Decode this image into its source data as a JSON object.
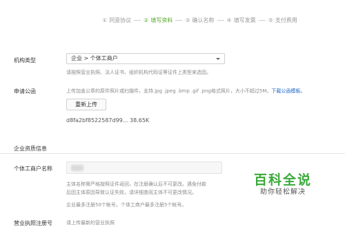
{
  "steps": [
    {
      "num": "①",
      "label": "同意协议"
    },
    {
      "num": "②",
      "label": "填写资料"
    },
    {
      "num": "③",
      "label": "确认名称"
    },
    {
      "num": "④",
      "label": "填写发票"
    },
    {
      "num": "⑤",
      "label": "支付费用"
    }
  ],
  "org_type": {
    "label": "机构类型",
    "selected": "企业 > 个体工商户",
    "hint": "请按照营业执照、法人证书、组织机构代码证等证件上类型来选因。"
  },
  "apply_letter": {
    "label": "申请公函",
    "hint": "上传加盖公章的原件照片或扫描件，支持.jpg .jpeg .bmp .gif .png格式照片，大小不超过5M。",
    "download_link": "下载公函模板。",
    "upload_button": "重新上传",
    "file_name": "d8fa2bf8522587d99...",
    "file_size": "38.65K"
  },
  "qualification": {
    "section_title": "企业资质信息",
    "name_label": "个体工商户名称",
    "name_value": "",
    "hint1": "主体名称需严格按照证件返回，在注册确认后不可更改。遇免付款",
    "hint2_pre": "后因主体原因导致认证失败，请详细查阅主体不可更改情况。",
    "hint3": "企业最多注册50个帐号，个体工商户最多注册5个帐号。",
    "next_label": "营业执照注册号",
    "next_hint": "请上传最新的营业执照"
  },
  "watermark": {
    "main": "百科全说",
    "sub": "助你轻松解决"
  }
}
